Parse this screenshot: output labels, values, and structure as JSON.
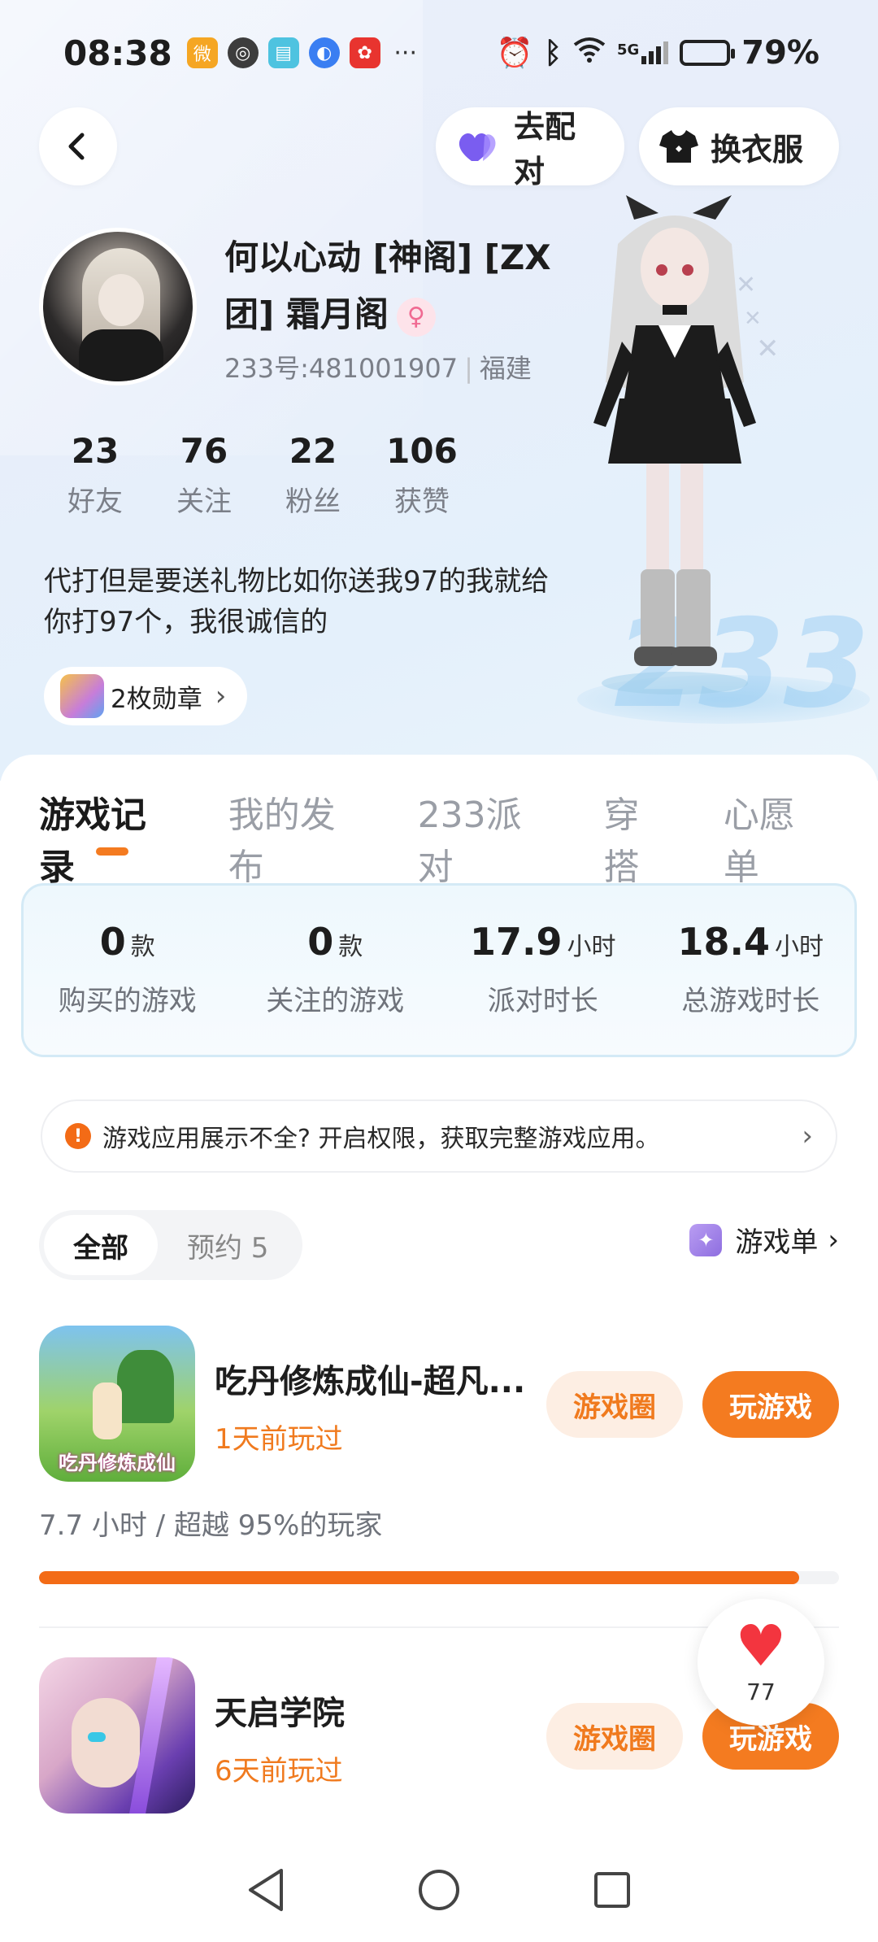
{
  "status_bar": {
    "time": "08:38",
    "network": "5G",
    "battery_pct": "79%",
    "battery_level": 0.79
  },
  "top_bar": {
    "match_label": "去配对",
    "dress_label": "换衣服"
  },
  "profile": {
    "name": "何以心动 [神阁] [ZX团] 霜月阁",
    "gender_icon": "female-icon",
    "uid": "233号:481001907",
    "location": "福建",
    "stats": [
      {
        "value": "23",
        "label": "好友"
      },
      {
        "value": "76",
        "label": "关注"
      },
      {
        "value": "22",
        "label": "粉丝"
      },
      {
        "value": "106",
        "label": "获赞"
      }
    ],
    "bio": "代打但是要送礼物比如你送我97的我就给你打97个，我很诚信的",
    "medal_label": "2枚勋章"
  },
  "tabs": [
    "游戏记录",
    "我的发布",
    "233派对",
    "穿搭",
    "心愿单"
  ],
  "summary": [
    {
      "value": "0",
      "unit": "款",
      "label": "购买的游戏"
    },
    {
      "value": "0",
      "unit": "款",
      "label": "关注的游戏"
    },
    {
      "value": "17.9",
      "unit": "小时",
      "label": "派对时长"
    },
    {
      "value": "18.4",
      "unit": "小时",
      "label": "总游戏时长"
    }
  ],
  "notice": "游戏应用展示不全? 开启权限，获取完整游戏应用。",
  "filter": {
    "all_label": "全部",
    "reserve_label": "预约 5",
    "gamelist_label": "游戏单"
  },
  "games": [
    {
      "title": "吃丹修炼成仙-超凡...",
      "played": "1天前玩过",
      "icon_caption": "吃丹修炼成仙",
      "circle_label": "游戏圈",
      "play_label": "玩游戏"
    },
    {
      "title": "天启学院",
      "played": "6天前玩过",
      "circle_label": "游戏圈",
      "play_label": "玩游戏"
    }
  ],
  "game1_progress": {
    "text": "7.7 小时 / 超越 95%的玩家",
    "fraction": 0.95
  },
  "like_count": "77",
  "colors": {
    "accent": "#f47b20",
    "accent_soft": "#fdeee3",
    "heart": "#f3353f"
  }
}
